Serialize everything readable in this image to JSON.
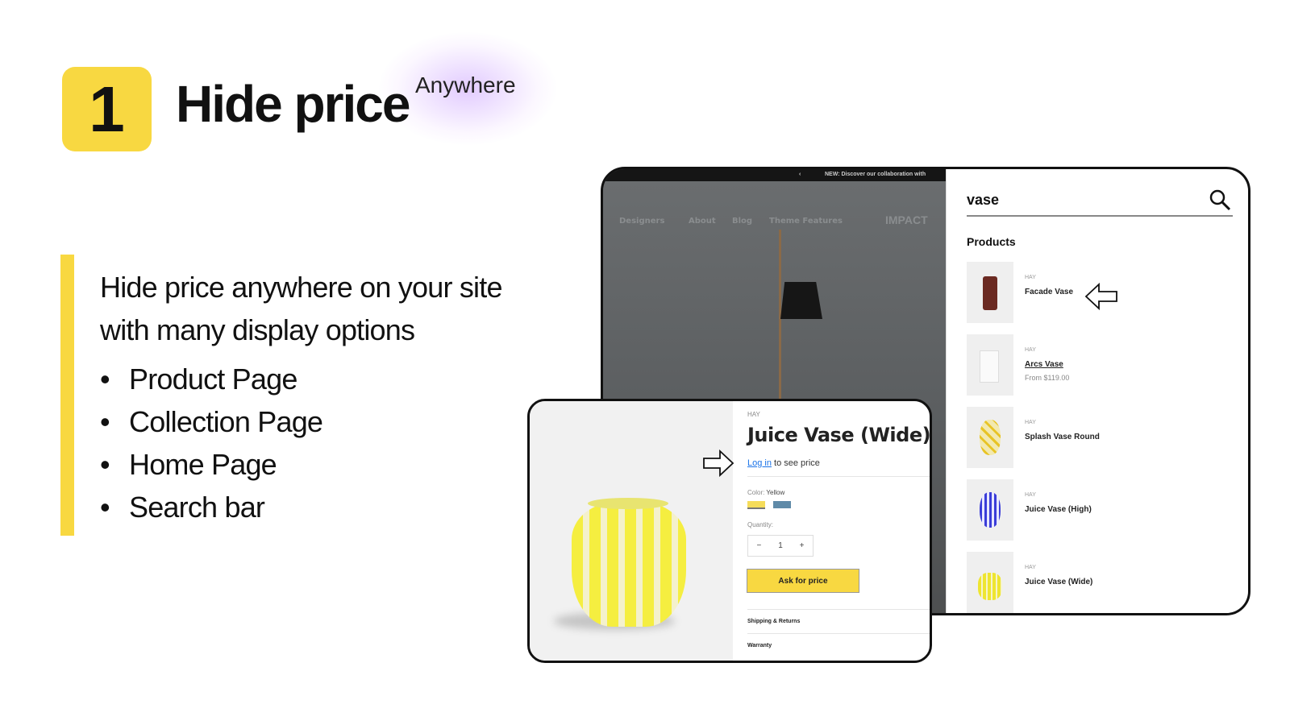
{
  "slide": {
    "number": "1",
    "title": "Hide price",
    "title_sup": "Anywhere",
    "description_line1": "Hide price anywhere on your site",
    "description_line2": "with many display options",
    "bullets": [
      "Product Page",
      "Collection Page",
      "Home Page",
      "Search bar"
    ],
    "accent": "#f8d841"
  },
  "store": {
    "announcement": "NEW: Discover our collaboration with",
    "nav": [
      "Designers",
      "About",
      "Blog",
      "Theme Features"
    ],
    "logo": "IMPACT"
  },
  "search": {
    "query": "vase",
    "section": "Products",
    "items": [
      {
        "brand": "HAY",
        "name": "Facade Vase",
        "price": ""
      },
      {
        "brand": "HAY",
        "name": "Arcs Vase",
        "price": "From $119.00"
      },
      {
        "brand": "HAY",
        "name": "Splash Vase Round",
        "price": ""
      },
      {
        "brand": "HAY",
        "name": "Juice Vase (High)",
        "price": ""
      },
      {
        "brand": "HAY",
        "name": "Juice Vase (Wide)",
        "price": ""
      }
    ]
  },
  "product": {
    "brand": "HAY",
    "title": "Juice Vase (Wide)",
    "login_link": "Log in",
    "login_rest": " to see price",
    "color_label": "Color:",
    "color_value": "Yellow",
    "quantity_label": "Quantity:",
    "quantity": "1",
    "minus": "−",
    "plus": "+",
    "ask_button": "Ask for price",
    "accordions": [
      "Shipping & Returns",
      "Warranty"
    ]
  }
}
